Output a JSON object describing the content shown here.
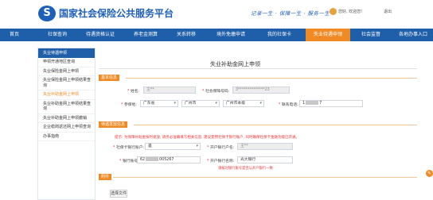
{
  "header": {
    "logo_letter": "S",
    "site_title": "国家社会保险公共服务平台",
    "slogan": "记录一生 · 保障一生 · 服务一生",
    "user_greeting": "您好, 欢迎您!",
    "logout_label": "退出"
  },
  "nav": {
    "items": [
      "首页",
      "社保查询",
      "待遇资格认证",
      "养老金测算",
      "关系转移",
      "境外免缴申请",
      "我的社保卡",
      "失业待遇申领",
      "社会监督",
      "各地办事入口"
    ],
    "active_index": 7
  },
  "sidebar": {
    "header": "失业待遇申领",
    "items": [
      "申领开通地区查询",
      "失业保险金网上申领",
      "失业保险金网上申领结果查询",
      "失业补助金网上申领",
      "失业补助金网上申领结果查询",
      "失业补助金网上申领撤销",
      "企业稳岗返还网上申领查询",
      "办事指南"
    ],
    "active_index": 3
  },
  "form": {
    "page_title": "失业补助金网上申领",
    "basic_section": "基本信息",
    "name_label": "姓名:",
    "name_value": "王**",
    "id_label": "社会保障号码:",
    "id_value": "3**************23",
    "insured_place_label": "参保地:",
    "province_value": "广东省",
    "city_value": "广州市",
    "district_value": "广州市本级",
    "phone_label": "联系电话:",
    "phone_prefix": "1",
    "phone_suffix": "7",
    "payment_section": "待遇发放信息",
    "notice": "提示: 为保障补助金按时发放, 请务必准确填写相关信息, 建议使用社保卡银行账户, 同时确保社保卡金融功能已开通。",
    "account_type_label": "社保卡银行账户:",
    "account_type_value": "是",
    "account_name_label": "开户银行户名:",
    "account_name_value": "王**",
    "bank_no_label": "银行账号:",
    "bank_no_prefix": "62",
    "bank_no_suffix": "005267",
    "bank_name_label": "开户银行名称:",
    "bank_name_value": "光大银行",
    "bank_hint": "请核对银行账号是否与开户银行一致",
    "attachment_section": "附件",
    "upload_button": "选择文件"
  },
  "colors": {
    "brand_blue": "#1f5ea8",
    "accent_orange": "#f08a24",
    "warning_red": "#e33333"
  }
}
